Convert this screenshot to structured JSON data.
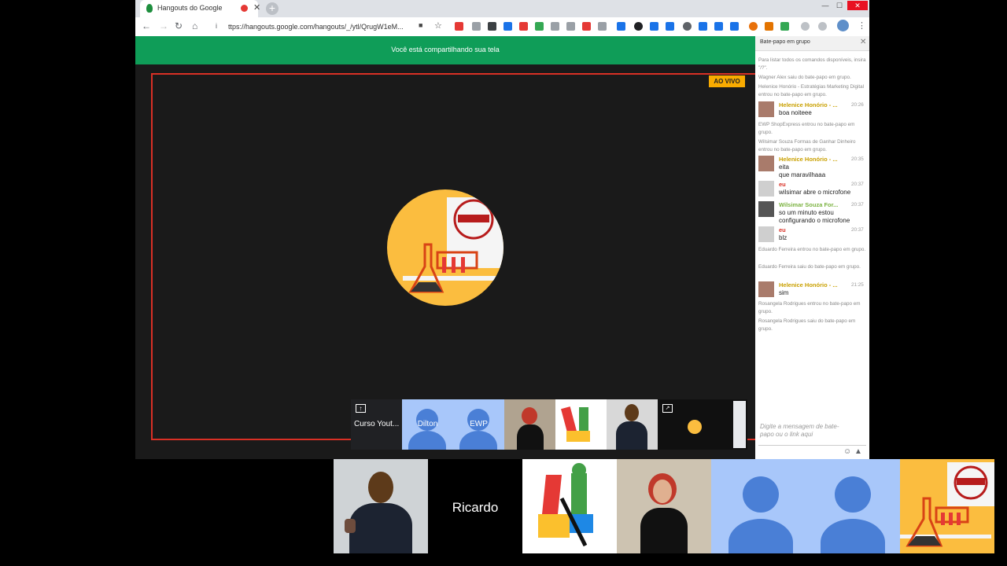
{
  "browser": {
    "tab_title": "Hangouts do Google",
    "url": "ttps://hangouts.google.com/hangouts/_/ytl/QrugW1eM...",
    "minimize": "—",
    "maximize": "☐",
    "close": "✕",
    "new_tab": "+"
  },
  "hangout": {
    "sharing_text": "Você está compartilhando sua tela",
    "live_badge": "AO VIVO"
  },
  "filmstrip": [
    {
      "label": "Curso Yout..."
    },
    {
      "label": "Dilton"
    },
    {
      "label": "EWP"
    }
  ],
  "chat": {
    "title": "Bate-papo em grupo",
    "input_placeholder": "Digite a mensagem de bate-papo ou o link aqui",
    "system_1": "Para listar todos os comandos disponíveis, insira \"/?\".",
    "system_2": "Wagner Alex saiu do bate-papo em grupo.",
    "system_3": "Helenice Honório - Estratégias Marketing Digital entrou no bate-papo em grupo.",
    "system_4": "EWP ShopExpress entrou no bate-papo em grupo.",
    "system_5": "Wilsimar Souza Formas de Ganhar Dinheiro entrou no bate-papo em grupo.",
    "system_6": "Eduardo Ferreira entrou no bate-papo em grupo.",
    "system_7": "Eduardo Ferreira saiu do bate-papo em grupo.",
    "system_8": "Rosangela Rodrigues entrou no bate-papo em grupo.",
    "system_9": "Rosangela Rodrigues saiu do bate-papo em grupo.",
    "msg_1": {
      "name": "Helenice Honório - ...",
      "time": "20:26",
      "text": "boa noiteee"
    },
    "msg_2": {
      "name": "Helenice Honório - ...",
      "time": "20:35",
      "text1": "eita",
      "text2": "que maravilhaaa"
    },
    "msg_3": {
      "name": "eu",
      "time": "20:37",
      "text": "wilsimar abre o microfone"
    },
    "msg_4": {
      "name": "Wilsimar Souza For...",
      "time": "20:37",
      "text1": "so um minuto estou",
      "text2": "configurando o microfone"
    },
    "msg_5": {
      "name": "eu",
      "time": "20:37",
      "text": "blz"
    },
    "msg_6": {
      "name": "Helenice Honório - ...",
      "time": "21:25",
      "text": "sim"
    }
  },
  "participants": {
    "ricardo_label": "Ricardo"
  },
  "colors": {
    "hangouts_green": "#0f9d58",
    "share_border": "#d93025",
    "live_badge": "#f9ab00"
  }
}
